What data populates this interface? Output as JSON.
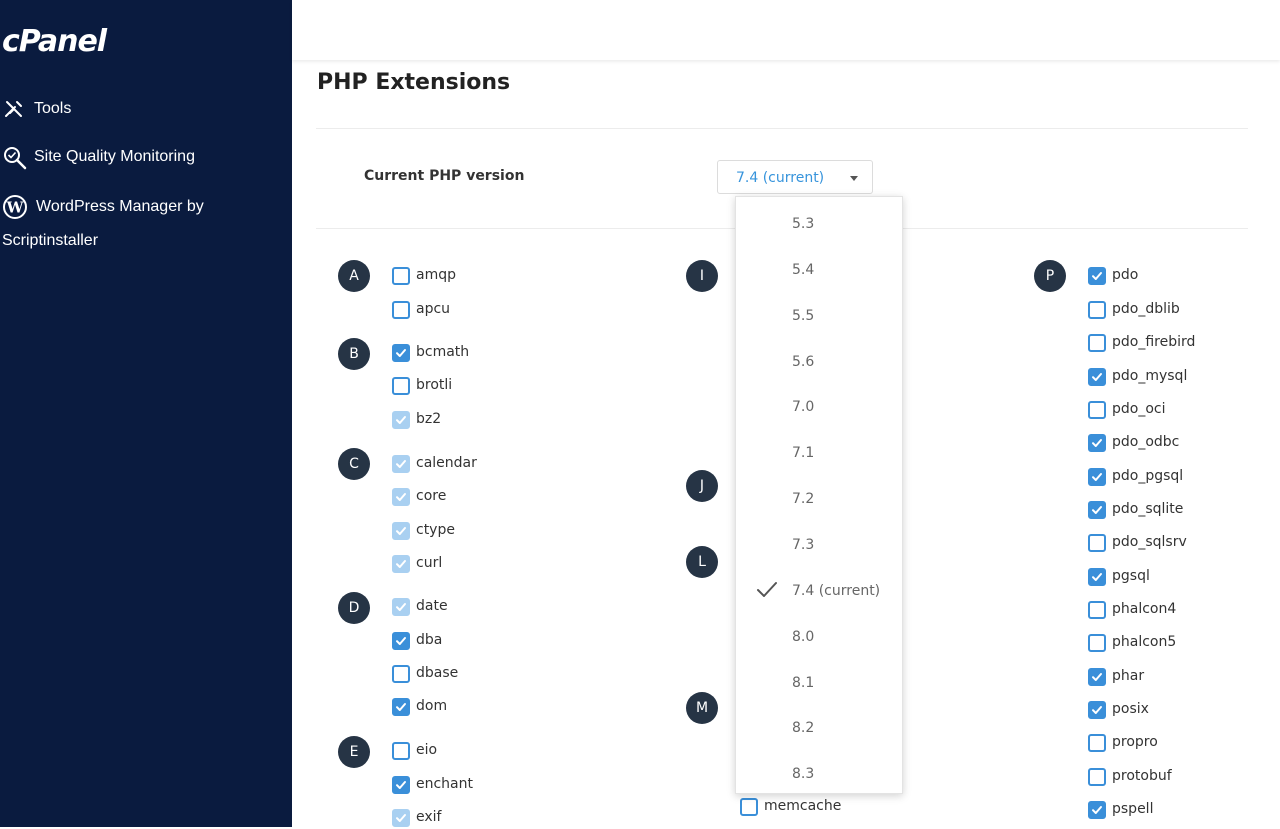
{
  "sidebar": {
    "logo": "cPanel",
    "items": [
      {
        "label": "Tools"
      },
      {
        "label": "Site Quality Monitoring"
      },
      {
        "label": "WordPress Manager by",
        "label2": "Scriptinstaller"
      }
    ]
  },
  "page": {
    "title": "PHP Extensions",
    "version_label": "Current PHP version",
    "version_value": "7.4 (current)"
  },
  "version_options": [
    "5.3",
    "5.4",
    "5.5",
    "5.6",
    "7.0",
    "7.1",
    "7.2",
    "7.3",
    "7.4 (current)",
    "8.0",
    "8.1",
    "8.2",
    "8.3"
  ],
  "selected_version": "7.4 (current)",
  "columns": [
    {
      "letters": [
        "A",
        "B",
        "C",
        "D",
        "E"
      ],
      "extensions": [
        {
          "name": "amqp",
          "checked": false,
          "disabled": false
        },
        {
          "name": "apcu",
          "checked": false,
          "disabled": false
        },
        {
          "name": "bcmath",
          "checked": true,
          "disabled": false
        },
        {
          "name": "brotli",
          "checked": false,
          "disabled": false
        },
        {
          "name": "bz2",
          "checked": true,
          "disabled": true
        },
        {
          "name": "calendar",
          "checked": true,
          "disabled": true
        },
        {
          "name": "core",
          "checked": true,
          "disabled": true
        },
        {
          "name": "ctype",
          "checked": true,
          "disabled": true
        },
        {
          "name": "curl",
          "checked": true,
          "disabled": true
        },
        {
          "name": "date",
          "checked": true,
          "disabled": true
        },
        {
          "name": "dba",
          "checked": true,
          "disabled": false
        },
        {
          "name": "dbase",
          "checked": false,
          "disabled": false
        },
        {
          "name": "dom",
          "checked": true,
          "disabled": false
        },
        {
          "name": "eio",
          "checked": false,
          "disabled": false
        },
        {
          "name": "enchant",
          "checked": true,
          "disabled": false
        },
        {
          "name": "exif",
          "checked": true,
          "disabled": true
        }
      ]
    },
    {
      "letters": [
        "I",
        "J",
        "L",
        "M"
      ],
      "extensions": [
        {
          "name": "memcache",
          "checked": false,
          "disabled": false
        }
      ]
    },
    {
      "letters": [
        "P"
      ],
      "extensions": [
        {
          "name": "pdo",
          "checked": true,
          "disabled": false
        },
        {
          "name": "pdo_dblib",
          "checked": false,
          "disabled": false
        },
        {
          "name": "pdo_firebird",
          "checked": false,
          "disabled": false
        },
        {
          "name": "pdo_mysql",
          "checked": true,
          "disabled": false
        },
        {
          "name": "pdo_oci",
          "checked": false,
          "disabled": false
        },
        {
          "name": "pdo_odbc",
          "checked": true,
          "disabled": false
        },
        {
          "name": "pdo_pgsql",
          "checked": true,
          "disabled": false
        },
        {
          "name": "pdo_sqlite",
          "checked": true,
          "disabled": false
        },
        {
          "name": "pdo_sqlsrv",
          "checked": false,
          "disabled": false
        },
        {
          "name": "pgsql",
          "checked": true,
          "disabled": false
        },
        {
          "name": "phalcon4",
          "checked": false,
          "disabled": false
        },
        {
          "name": "phalcon5",
          "checked": false,
          "disabled": false
        },
        {
          "name": "phar",
          "checked": true,
          "disabled": false
        },
        {
          "name": "posix",
          "checked": true,
          "disabled": false
        },
        {
          "name": "propro",
          "checked": false,
          "disabled": false
        },
        {
          "name": "protobuf",
          "checked": false,
          "disabled": false
        },
        {
          "name": "pspell",
          "checked": true,
          "disabled": false
        }
      ]
    }
  ],
  "colors": {
    "sidebar_bg": "#0a1b3f",
    "accent": "#3a8fd9",
    "accent_disabled": "#a9d0f1",
    "letter_badge": "#263445",
    "version_text": "#3794dc"
  }
}
